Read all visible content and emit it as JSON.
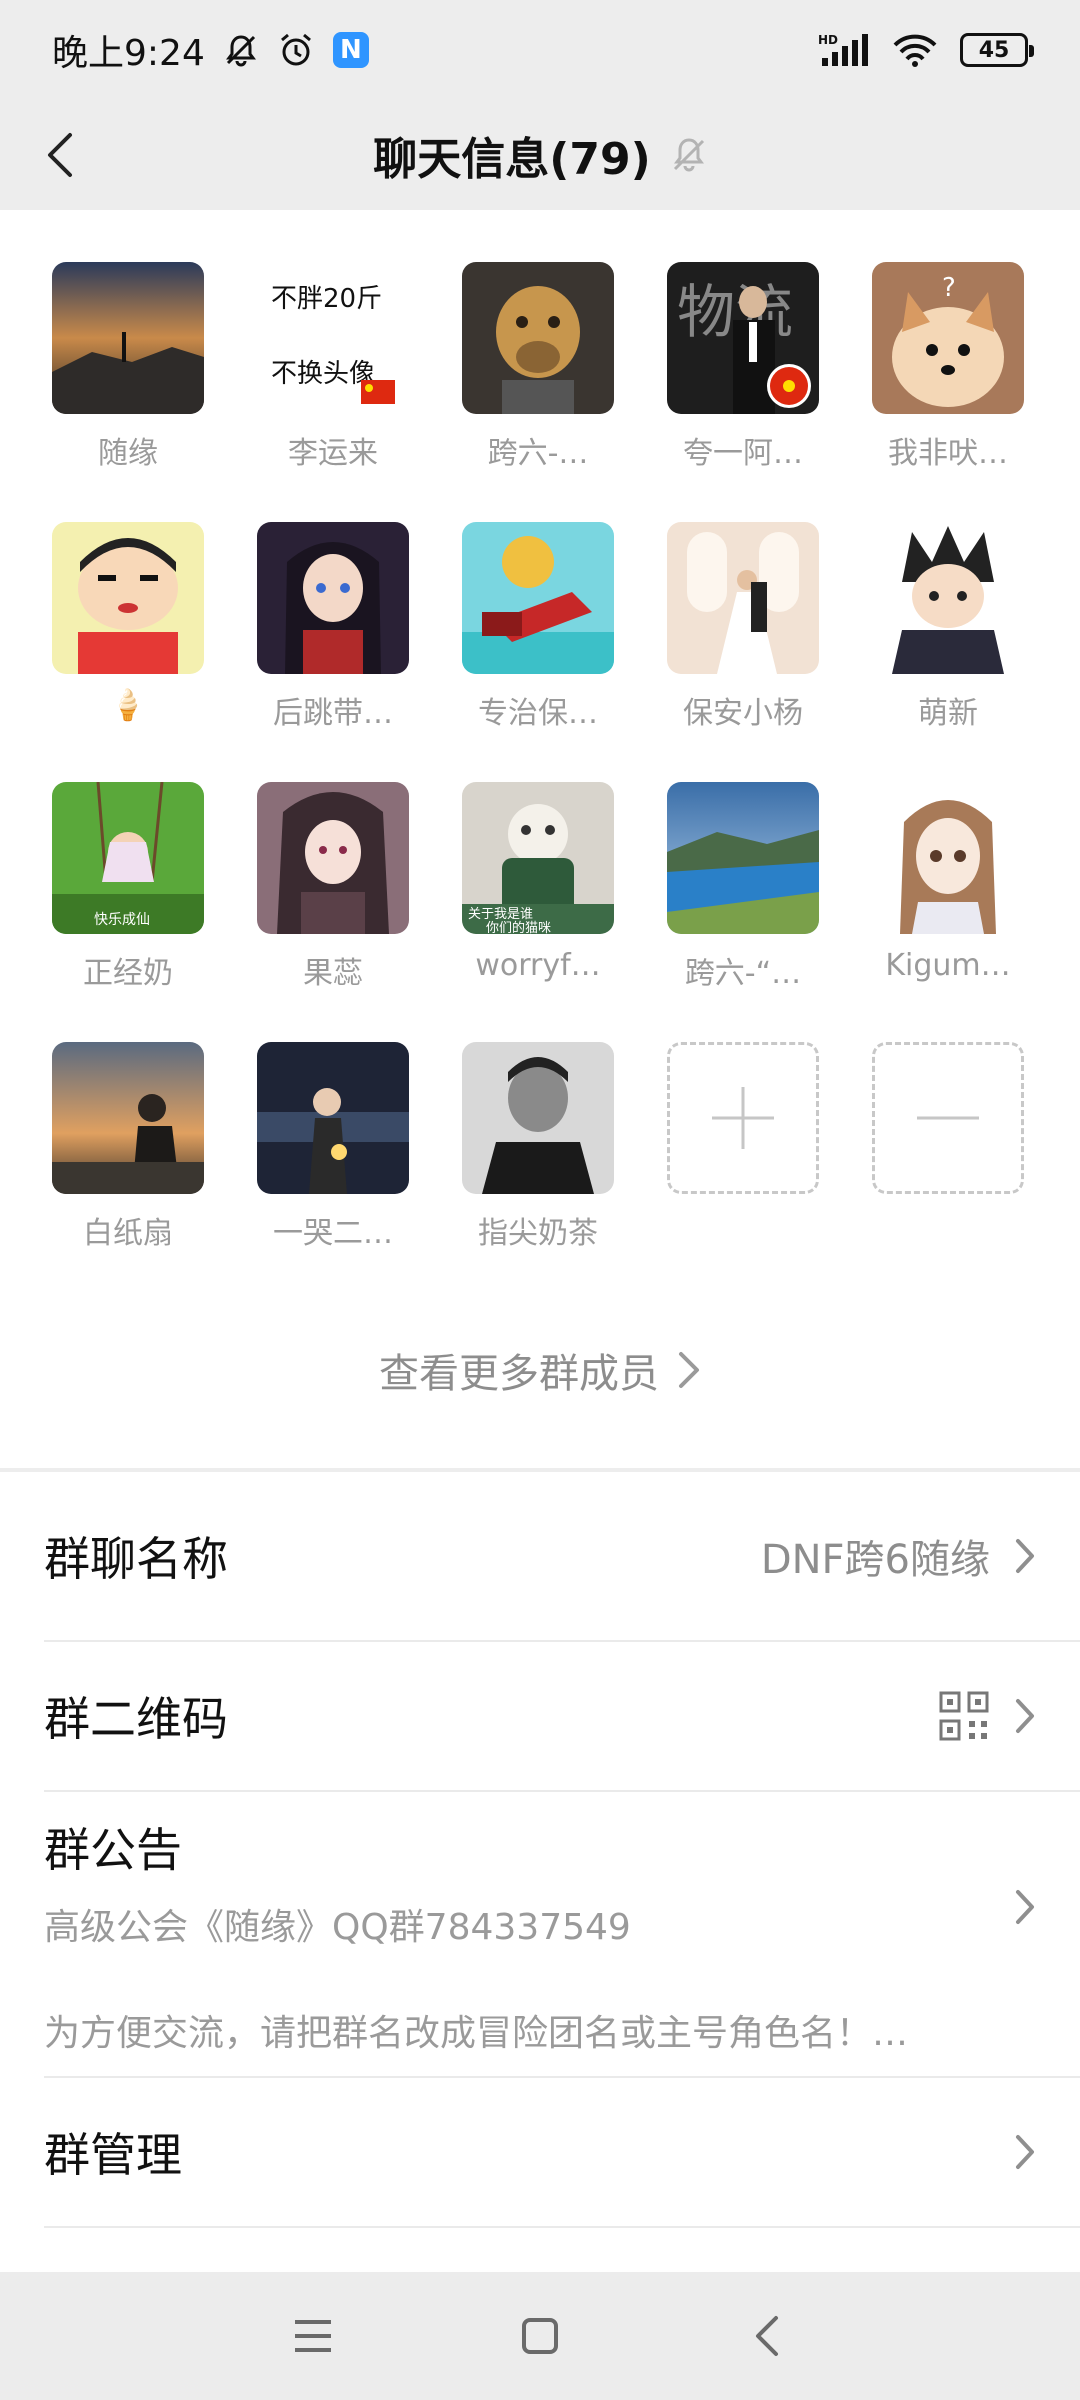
{
  "status_bar": {
    "time": "晚上9:24",
    "battery": "45"
  },
  "header": {
    "title": "聊天信息(79)"
  },
  "members": [
    {
      "name": "随缘"
    },
    {
      "name": "李运来"
    },
    {
      "name": "跨六-…"
    },
    {
      "name": "夸一阿…"
    },
    {
      "name": "我非吠…"
    },
    {
      "name": "🍦"
    },
    {
      "name": "后跳带…"
    },
    {
      "name": "专治保…"
    },
    {
      "name": "保安小杨"
    },
    {
      "name": "萌新"
    },
    {
      "name": "正经奶"
    },
    {
      "name": "果蕊"
    },
    {
      "name": "worryf…"
    },
    {
      "name": "跨六-“…"
    },
    {
      "name": "Kigum…"
    },
    {
      "name": "白纸扇"
    },
    {
      "name": "一哭二…"
    },
    {
      "name": "指尖奶茶"
    }
  ],
  "avatar_texts": {
    "li_line1": "不胖20斤",
    "li_line2": "不换头像",
    "wuliu": "物流",
    "question": "?",
    "kuaile": "快乐成仙",
    "worry1": "关于我是谁",
    "worry2": "你们的猫咪"
  },
  "more_members_label": "查看更多群成员",
  "settings": {
    "group_name_label": "群聊名称",
    "group_name_value": "DNF跨6随缘",
    "qr_label": "群二维码",
    "notice_label": "群公告",
    "notice_line1": "高级公会《随缘》QQ群784337549",
    "notice_line2": "为方便交流，请把群名改成冒险团名或主号角色名！…",
    "manage_label": "群管理"
  },
  "colors": {
    "background": "#ededed",
    "panel": "#ffffff",
    "secondary_text": "#9a9a9a",
    "badge_blue": "#2f95ff"
  }
}
